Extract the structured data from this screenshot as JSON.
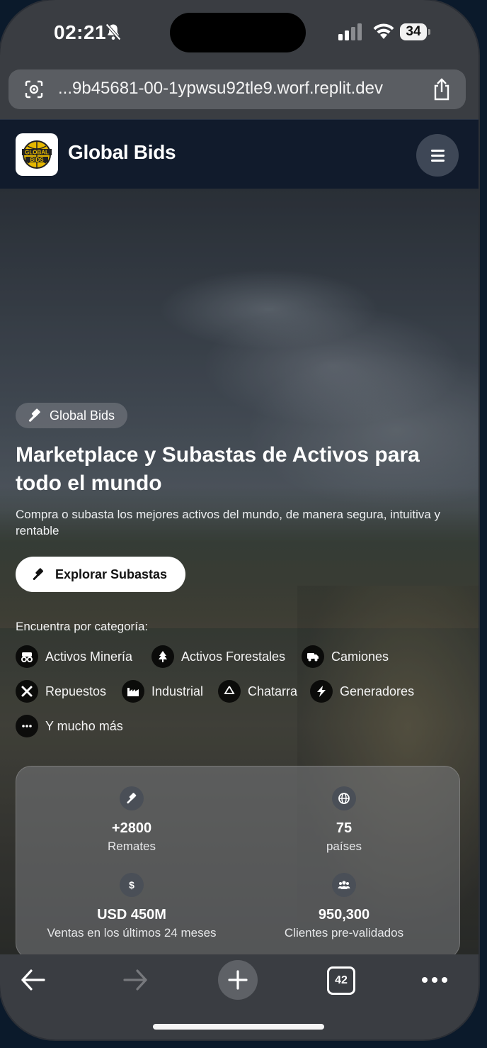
{
  "status_bar": {
    "time": "02:21",
    "battery": "34"
  },
  "browser": {
    "url": "...9b45681-00-1ypwsu92tle9.worf.replit.dev",
    "open_tabs": "42"
  },
  "header": {
    "brand": "Global Bids",
    "logo_text": "GLOBAL BIDS"
  },
  "hero": {
    "badge": "Global Bids",
    "title": "Marketplace y Subastas de Activos para todo el mundo",
    "subtitle": "Compra o subasta los mejores activos del mundo, de manera segura, intuitiva y rentable",
    "cta": "Explorar Subastas",
    "category_heading": "Encuentra por categoría:"
  },
  "categories": [
    {
      "label": "Activos Minería",
      "icon": "mining-truck-icon"
    },
    {
      "label": "Activos Forestales",
      "icon": "tree-icon"
    },
    {
      "label": "Camiones",
      "icon": "truck-icon"
    },
    {
      "label": "Repuestos",
      "icon": "tools-icon"
    },
    {
      "label": "Industrial",
      "icon": "factory-icon"
    },
    {
      "label": "Chatarra",
      "icon": "recycle-icon"
    },
    {
      "label": "Generadores",
      "icon": "bolt-icon"
    },
    {
      "label": "Y mucho más",
      "icon": "ellipsis-icon"
    }
  ],
  "stats": [
    {
      "value": "+2800",
      "label": "Remates",
      "icon": "gavel-icon"
    },
    {
      "value": "75",
      "label": "países",
      "icon": "globe-icon"
    },
    {
      "value": "USD 450M",
      "label": "Ventas en los últimos 24 meses",
      "icon": "dollar-icon"
    },
    {
      "value": "950,300",
      "label": "Clientes pre-validados",
      "icon": "users-icon"
    }
  ],
  "colors": {
    "header_bg": "#111b2c",
    "browser_chrome": "#3a3d42",
    "cta_bg": "#ffffff"
  }
}
